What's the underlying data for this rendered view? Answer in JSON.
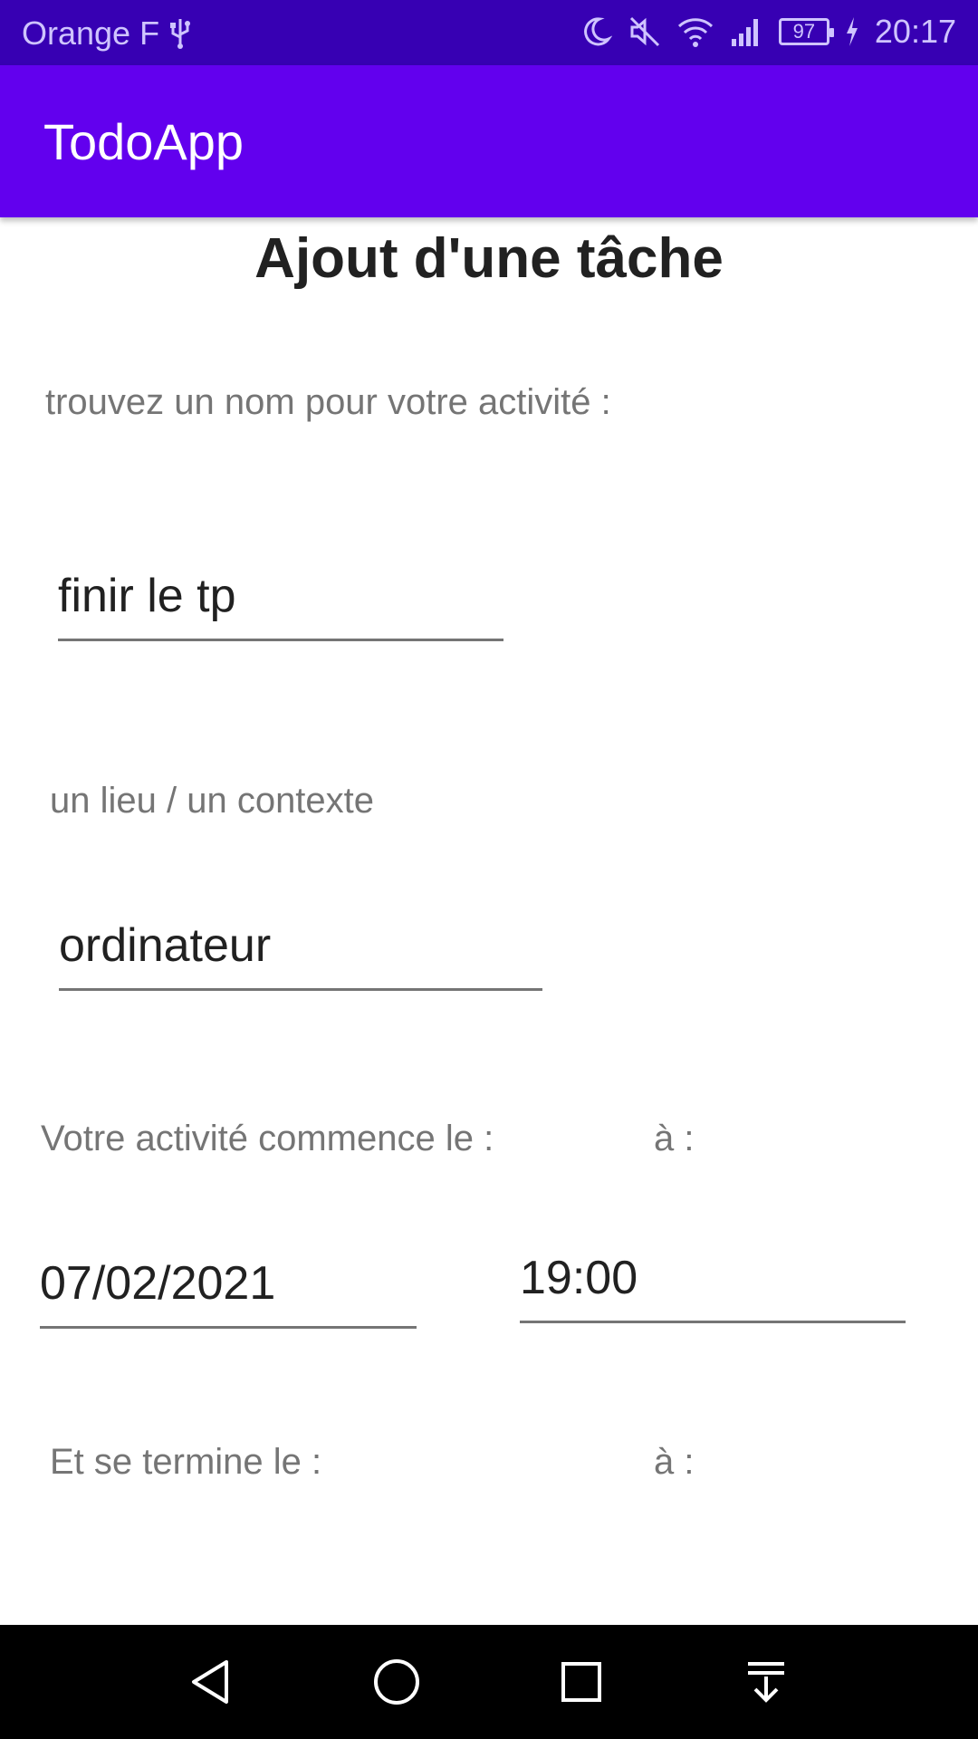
{
  "status_bar": {
    "carrier": "Orange F",
    "battery": "97",
    "time": "20:17"
  },
  "app_bar": {
    "title": "TodoApp"
  },
  "form": {
    "heading": "Ajout d'une tâche",
    "name_label": "trouvez un nom pour votre activité :",
    "name_value": "finir le tp",
    "place_label": "un lieu / un contexte",
    "place_value": "ordinateur",
    "start_label": "Votre activité commence le :",
    "start_time_label": "à :",
    "start_date_value": "07/02/2021",
    "start_time_value": "19:00",
    "end_label": "Et se termine le :",
    "end_time_label": "à :"
  },
  "colors": {
    "status_bar": "#3700b3",
    "app_bar": "#6200ee",
    "nav_bar": "#000000"
  },
  "icons": [
    "usb-icon",
    "moon-icon",
    "mute-icon",
    "wifi-icon",
    "signal-icon",
    "charging-icon",
    "back-icon",
    "home-icon",
    "recents-icon",
    "notification-pull-icon"
  ]
}
